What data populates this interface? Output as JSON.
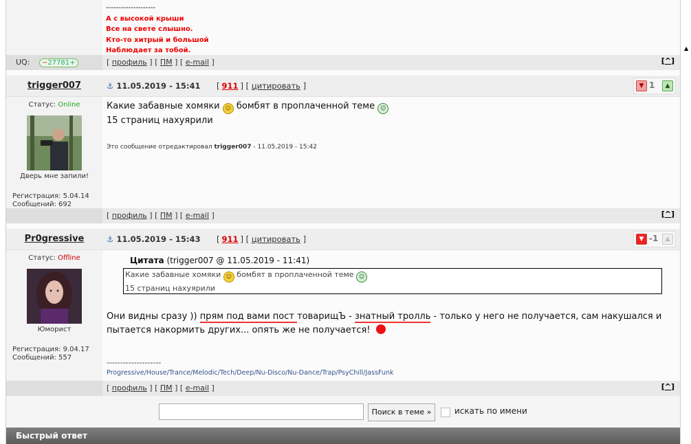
{
  "signature_prev": {
    "dashes": "--------------------",
    "lines": [
      "А с высокой крыши",
      "Все на свете слышно.",
      "Кто-то хитрый и большой",
      "Наблюдает за тобой."
    ]
  },
  "uq": {
    "label": "UQ:",
    "minus": "−",
    "value": "27781",
    "plus": "+"
  },
  "bar_links": {
    "profile": "профиль",
    "pm": "ПМ",
    "email": "e-mail",
    "top": "^"
  },
  "posts": [
    {
      "nick": "trigger007",
      "date": "11.05.2019 - 15:41",
      "post_num": "911",
      "cite": "цитировать",
      "rating": "1",
      "status_label": "Статус:",
      "status": "Online",
      "user_title": "Дверь мне запили!",
      "reg": "Регистрация: 5.04.14",
      "msgs": "Сообщений: 692",
      "text_line1_a": "Какие забавные хомяки",
      "text_line1_b": "бомбят в проплаченной теме",
      "text_line2": "15 страниц нахуярили",
      "edited_prefix": "Это сообщение отредактировал",
      "edited_user": "trigger007",
      "edited_date": "- 11.05.2019 - 15:42"
    },
    {
      "nick": "Pr0gressive",
      "date": "11.05.2019 - 15:43",
      "post_num": "911",
      "cite": "цитировать",
      "rating": "-1",
      "status_label": "Статус:",
      "status": "Offline",
      "user_title": "Юморист",
      "reg": "Регистрация: 9.04.17",
      "msgs": "Сообщений: 557",
      "quote_label": "Цитата",
      "quote_meta": "(trigger007 @ 11.05.2019 - 11:41)",
      "quote_line1_a": "Какие забавные хомяки",
      "quote_line1_b": "бомбят в проплаченной теме",
      "quote_line2": "15 страниц нахуярили",
      "text_a": "Они видны сразу )) ",
      "text_u1": "прям под вами пост ",
      "text_b": "товарищЪ - ",
      "text_u2": "знатный тролль",
      "text_c": " - только у него не получается, сам накушался и",
      "text_line2": "пытается накормить других... опять же не получается!",
      "sig_dashes": "--------------------",
      "sig_genres": "Progressive/House/Trance/Melodic/Tech/Deep/Nu-Disco/Nu-Dance/Trap/PsyChill/JassFunk"
    }
  ],
  "search": {
    "button": "Поиск в теме »",
    "checkbox_label": "искать по имени"
  },
  "quick_reply": "Быстрый ответ"
}
